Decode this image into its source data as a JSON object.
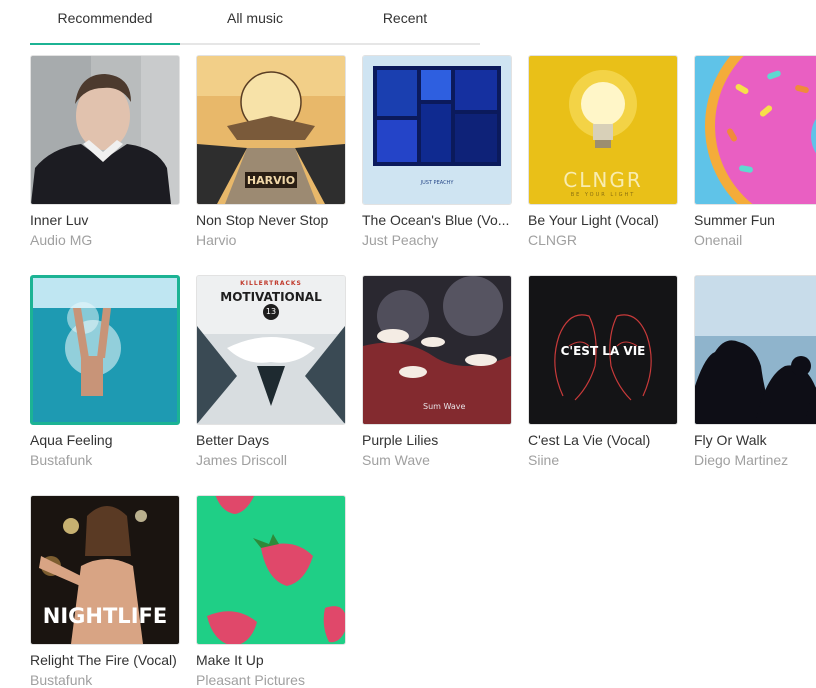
{
  "tabs": [
    {
      "label": "Recommended",
      "active": true
    },
    {
      "label": "All music",
      "active": false
    },
    {
      "label": "Recent",
      "active": false
    }
  ],
  "accent_color": "#1cb394",
  "tracks": [
    {
      "title": "Inner Luv",
      "artist": "Audio MG"
    },
    {
      "title": "Non Stop Never Stop",
      "artist": "Harvio",
      "cover_text": "HARVIO"
    },
    {
      "title": "The Ocean's Blue (Vo...",
      "artist": "Just Peachy",
      "cover_text": "JUST PEACHY"
    },
    {
      "title": "Be Your Light (Vocal)",
      "artist": "CLNGR",
      "cover_text": "CLNGR",
      "cover_subtext": "BE YOUR LIGHT"
    },
    {
      "title": "Summer Fun",
      "artist": "Onenail"
    },
    {
      "title": "Aqua Feeling",
      "artist": "Bustafunk",
      "selected": true
    },
    {
      "title": "Better Days",
      "artist": "James Driscoll",
      "cover_brand": "KILLERTRACKS",
      "cover_text": "MOTIVATIONAL",
      "cover_number": "13"
    },
    {
      "title": "Purple Lilies",
      "artist": "Sum Wave",
      "cover_text": "Sum Wave"
    },
    {
      "title": "C'est La Vie (Vocal)",
      "artist": "Siine",
      "cover_text": "C'EST LA VIE"
    },
    {
      "title": "Fly Or Walk",
      "artist": "Diego Martinez"
    },
    {
      "title": "Relight The Fire (Vocal)",
      "artist": "Bustafunk",
      "cover_text": "NIGHTLIFE"
    },
    {
      "title": "Make It Up",
      "artist": "Pleasant Pictures"
    }
  ]
}
